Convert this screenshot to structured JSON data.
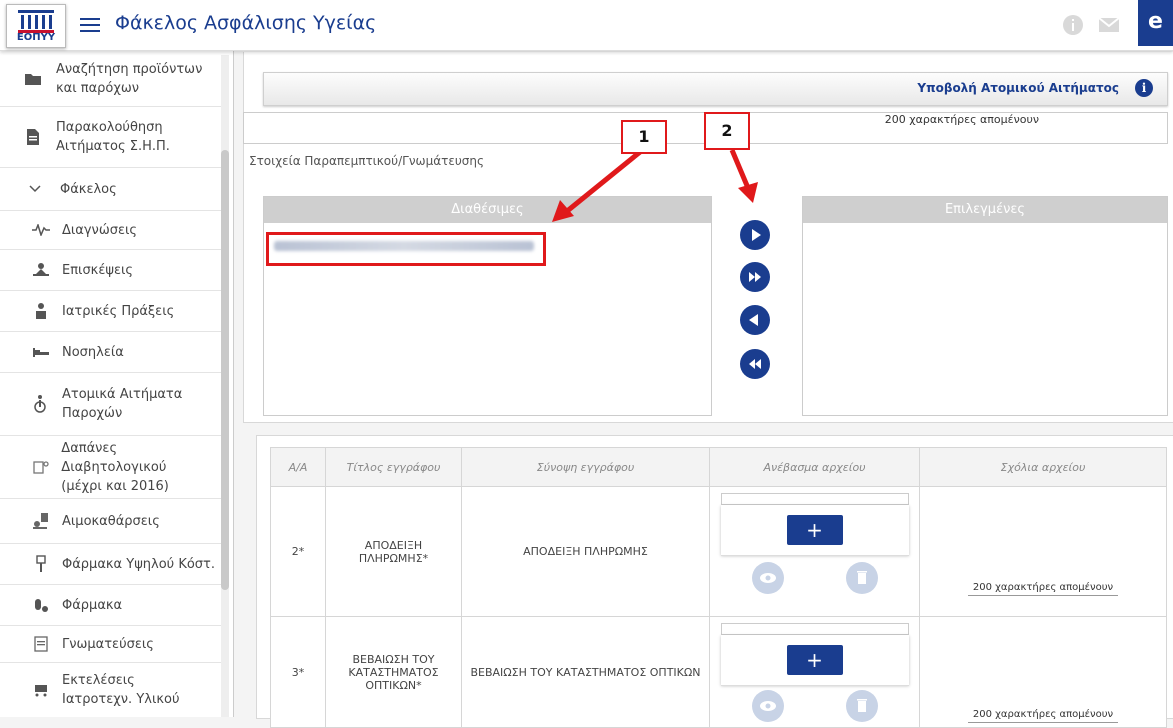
{
  "header": {
    "logo_text": "ΕΟΠΥΥ",
    "title": "Φάκελος Ασφάλισης Υγείας",
    "user_initial": "e",
    "brand_color": "#1a3d8f"
  },
  "sidebar": {
    "items": [
      {
        "label_1": "Αναζήτηση προϊόντων",
        "label_2": "και παρόχων",
        "icon": "folder-search-icon"
      },
      {
        "label_1": "Παρακολούθηση",
        "label_2": "Αιτήματος Σ.Η.Π.",
        "icon": "document-icon"
      },
      {
        "label_1": "Φάκελος",
        "icon": "chevron-down-icon"
      },
      {
        "label_1": "Διαγνώσεις",
        "icon": "pulse-icon"
      },
      {
        "label_1": "Επισκέψεις",
        "icon": "visit-icon"
      },
      {
        "label_1": "Ιατρικές Πράξεις",
        "icon": "medical-act-icon"
      },
      {
        "label_1": "Νοσηλεία",
        "icon": "bed-icon"
      },
      {
        "label_1": "Ατομικά Αιτήματα",
        "label_2": "Παροχών",
        "icon": "wheelchair-icon"
      },
      {
        "label_1": "Δαπάνες Διαβητολογικού",
        "label_2": "(μέχρι και 2016)",
        "icon": "diabetes-icon"
      },
      {
        "label_1": "Αιμοκαθάρσεις",
        "icon": "dialysis-icon"
      },
      {
        "label_1": "Φάρμακα Υψηλού Κόστ.",
        "icon": "iv-drip-icon"
      },
      {
        "label_1": "Φάρμακα",
        "icon": "pills-icon"
      },
      {
        "label_1": "Γνωματεύσεις",
        "icon": "note-icon"
      },
      {
        "label_1": "Εκτελέσεις",
        "label_2": "Ιατροτεχν. Υλικού",
        "icon": "cart-icon"
      }
    ]
  },
  "main": {
    "submit_label": "Υποβολή Ατομικού Αιτήματος",
    "chars_remaining_top": "200 χαρακτήρες απομένουν",
    "section_label": "Στοιχεία Παραπεμπτικού/Γνωμάτευσης",
    "available_header": "Διαθέσιμες",
    "selected_header": "Επιλεγμένες",
    "callout_1": "1",
    "callout_2": "2"
  },
  "table": {
    "headers": [
      "Α/Α",
      "Τίτλος εγγράφου",
      "Σύνοψη εγγράφου",
      "Ανέβασμα αρχείου",
      "Σχόλια αρχείου"
    ],
    "rows": [
      {
        "aa": "2*",
        "title": "ΑΠΟΔΕΙΞΗ ΠΛΗΡΩΜΗΣ*",
        "summary": "ΑΠΟΔΕΙΞΗ ΠΛΗΡΩΜΗΣ",
        "upload": "+",
        "comment": "200 χαρακτήρες απομένουν"
      },
      {
        "aa": "3*",
        "title": "ΒΕΒΑΙΩΣΗ ΤΟΥ ΚΑΤΑΣΤΗΜΑΤΟΣ ΟΠΤΙΚΩΝ*",
        "summary": "ΒΕΒΑΙΩΣΗ ΤΟΥ ΚΑΤΑΣΤΗΜΑΤΟΣ ΟΠΤΙΚΩΝ",
        "upload": "+",
        "comment": "200 χαρακτήρες απομένουν"
      }
    ]
  }
}
